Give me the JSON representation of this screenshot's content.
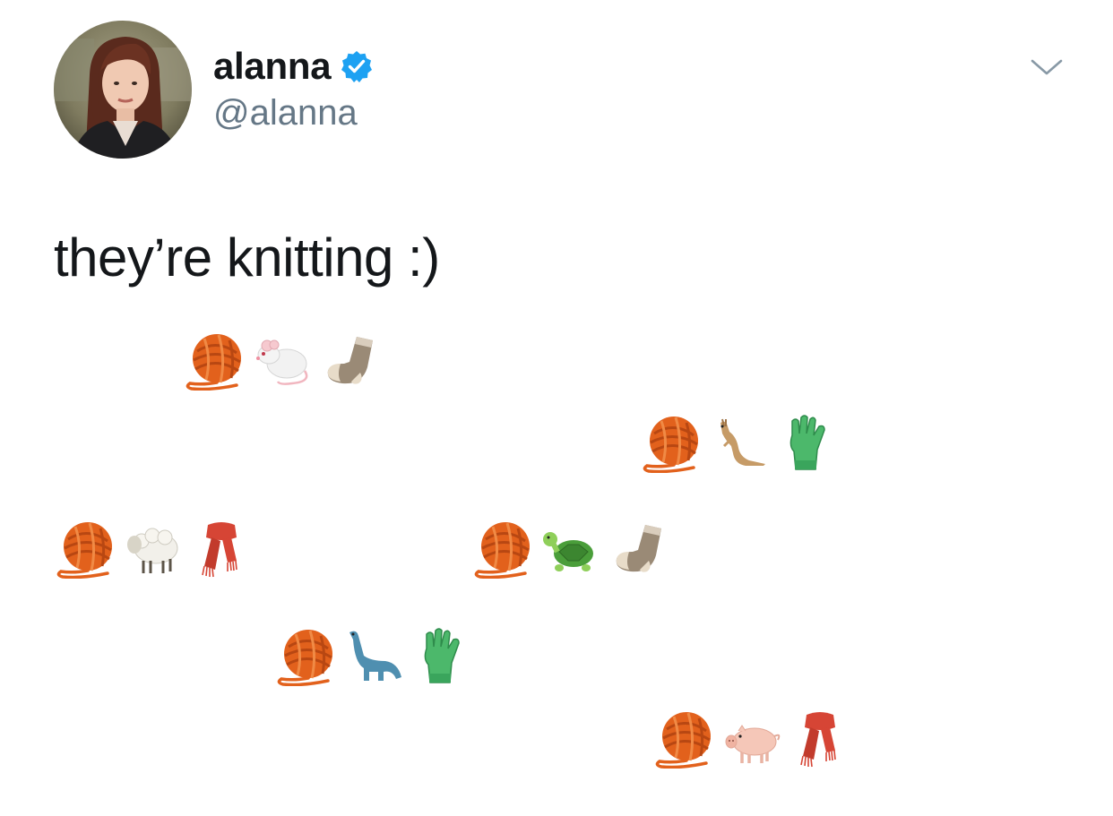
{
  "user": {
    "display_name": "alanna",
    "handle": "@alanna",
    "verified": true
  },
  "tweet": {
    "text": "they’re knitting :)"
  },
  "icons": {
    "caret": "chevron-down-icon",
    "badge": "verified-badge-icon"
  },
  "colors": {
    "verified_blue": "#1da1f2",
    "handle_gray": "#657786",
    "text_black": "#14171a"
  },
  "emoji_rows": [
    [
      "yarn",
      "rat",
      "sock"
    ],
    [
      "yarn",
      "kangaroo",
      "gloves"
    ],
    [
      "yarn",
      "sheep",
      "scarf"
    ],
    [
      "yarn",
      "turtle",
      "sock"
    ],
    [
      "yarn",
      "sauropod",
      "gloves"
    ],
    [
      "yarn",
      "pig",
      "scarf"
    ]
  ]
}
